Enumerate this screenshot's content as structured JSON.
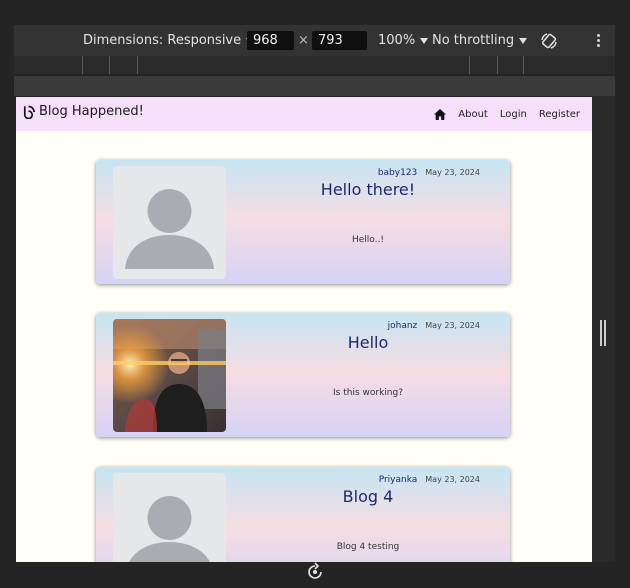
{
  "devtools": {
    "dimensions_label": "Dimensions: Responsive",
    "width": "968",
    "height": "793",
    "times": "×",
    "zoom": "100%",
    "throttling": "No throttling"
  },
  "site": {
    "brand": "Blog Happened!",
    "nav": {
      "about": "About",
      "login": "Login",
      "register": "Register"
    }
  },
  "posts": [
    {
      "author": "baby123",
      "date": "May 23, 2024",
      "title": "Hello there!",
      "body": "Hello..!",
      "image": "default-avatar"
    },
    {
      "author": "johanz",
      "date": "May 23, 2024",
      "title": "Hello",
      "body": "Is this working?",
      "image": "photo"
    },
    {
      "author": "Priyanka",
      "date": "May 23, 2024",
      "title": "Blog 4",
      "body": "Blog 4 testing",
      "image": "default-avatar"
    }
  ]
}
